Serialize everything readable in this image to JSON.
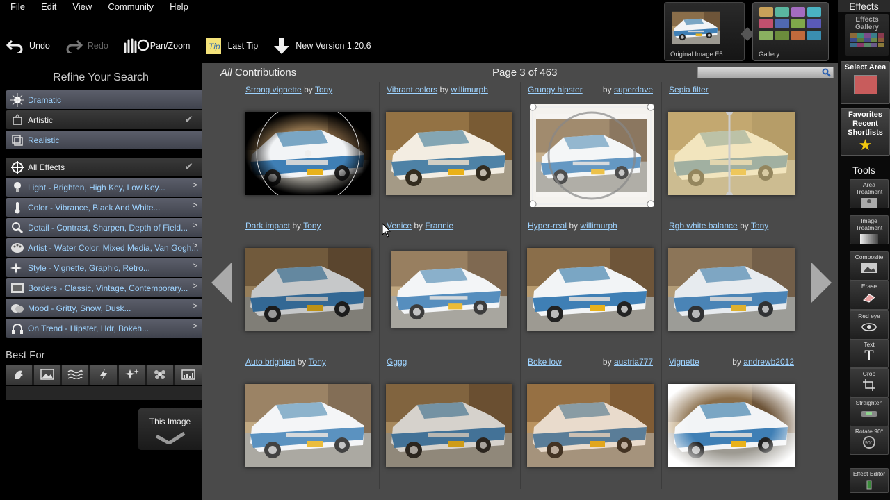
{
  "menu": [
    "File",
    "Edit",
    "View",
    "Community",
    "Help"
  ],
  "toolbar": {
    "undo": "Undo",
    "redo": "Redo",
    "panzoom": "Pan/Zoom",
    "lasttip": "Last Tip",
    "newversion": "New Version 1.20.6"
  },
  "thumbs": {
    "original": "Original Image F5",
    "gallery": "Gallery"
  },
  "right": {
    "effects": "Effects",
    "effects_gallery": "Effects Gallery",
    "select_area": "Select Area",
    "favorites": "Favorites Recent Shortlists",
    "tools": "Tools",
    "tool_items": [
      "Area Treatment",
      "Image Treatment",
      "Composite",
      "Erase",
      "Red eye",
      "Text",
      "Crop",
      "Straighten",
      "Rotate 90°",
      "Effect Editor"
    ]
  },
  "left": {
    "refine": "Refine Your Search",
    "categories": [
      {
        "label": "Dramatic"
      },
      {
        "label": "Artistic"
      },
      {
        "label": "Realistic"
      },
      {
        "label": "All Effects"
      },
      {
        "label": "Light - Brighten, High Key, Low Key..."
      },
      {
        "label": "Color - Vibrance, Black And White..."
      },
      {
        "label": "Detail - Contrast, Sharpen, Depth of Field..."
      },
      {
        "label": "Artist - Water Color, Mixed Media, Van Gogh..."
      },
      {
        "label": "Style - Vignette, Graphic, Retro..."
      },
      {
        "label": "Borders - Classic, Vintage, Contemporary..."
      },
      {
        "label": "Mood - Gritty, Snow, Dusk..."
      },
      {
        "label": "On Trend - Hipster, Hdr, Bokeh..."
      }
    ],
    "bestfor": "Best For",
    "this_image": "This Image"
  },
  "main": {
    "all_prefix": "All",
    "contributions": " Contributions",
    "page": "Page 3 of 463",
    "search_placeholder": "",
    "by": "by",
    "cells": [
      {
        "name": "Strong vignette",
        "author": "Tony"
      },
      {
        "name": "Vibrant colors",
        "author": "willimurph"
      },
      {
        "name": "Grungy hipster",
        "author": "superdave"
      },
      {
        "name": "Sepia filter",
        "author": ""
      },
      {
        "name": "Dark impact",
        "author": "Tony"
      },
      {
        "name": "Venice",
        "author": "Frannie"
      },
      {
        "name": "Hyper-real",
        "author": "willimurph"
      },
      {
        "name": "Rgb white balance",
        "author": "Tony"
      },
      {
        "name": "Auto brighten",
        "author": "Tony"
      },
      {
        "name": "Gggg",
        "author": ""
      },
      {
        "name": "Boke low",
        "author": "austria777"
      },
      {
        "name": "Vignette",
        "author": "andrewb2012"
      }
    ]
  }
}
